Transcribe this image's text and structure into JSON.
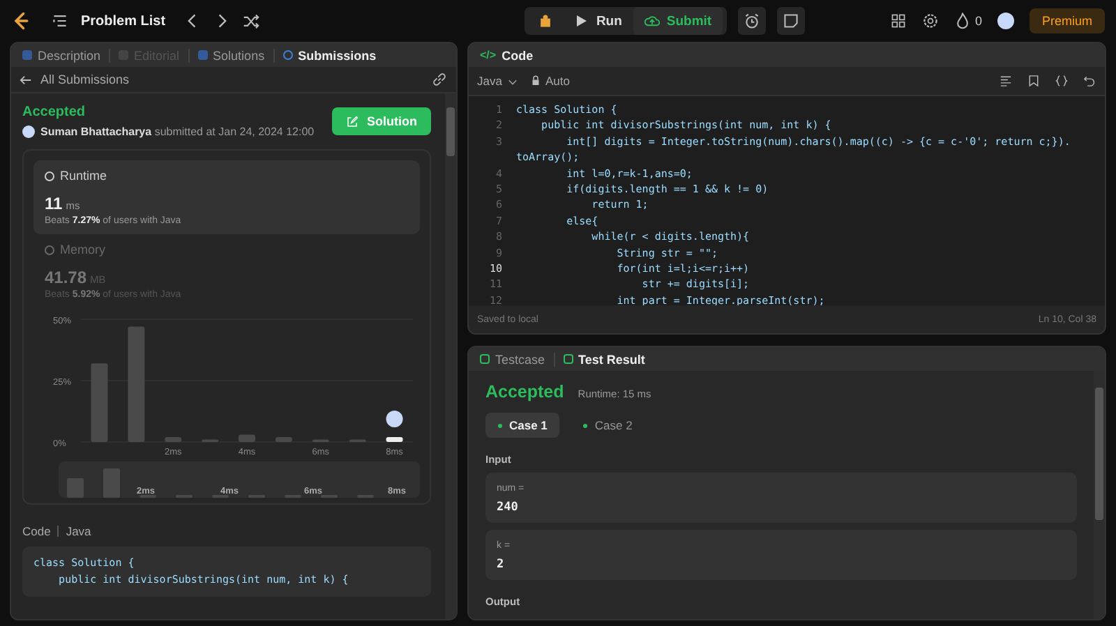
{
  "top_bar": {
    "title": "Problem List",
    "run_label": "Run",
    "submit_label": "Submit",
    "streak": "0",
    "premium": "Premium"
  },
  "left_panel": {
    "tabs": [
      {
        "label": "Description",
        "selected": false,
        "disabled": false
      },
      {
        "label": "Editorial",
        "selected": false,
        "disabled": true
      },
      {
        "label": "Solutions",
        "selected": false,
        "disabled": false
      },
      {
        "label": "Submissions",
        "selected": true,
        "disabled": false
      }
    ],
    "back_label": "All Submissions",
    "status": "Accepted",
    "author": "Suman Bhattacharya",
    "submitted": "submitted at Jan 24, 2024 12:00",
    "solution_button": "Solution",
    "stats": [
      {
        "title": "Runtime",
        "value": "11",
        "unit": "ms",
        "beats_prefix": "Beats",
        "beats": "7.27%",
        "beats_suffix": "of users with Java",
        "selected": true
      },
      {
        "title": "Memory",
        "value": "41.78",
        "unit": "MB",
        "beats_prefix": "Beats",
        "beats": "5.92%",
        "beats_suffix": "of users with Java",
        "selected": false
      }
    ],
    "chart_data": {
      "type": "bar",
      "x": [
        0,
        1,
        2,
        3,
        4,
        5,
        6,
        7,
        8
      ],
      "values": [
        32,
        47,
        2,
        1,
        3,
        2,
        1,
        1,
        2
      ],
      "ylim": [
        0,
        50
      ],
      "yticks": [
        {
          "value": 0,
          "label": "0%"
        },
        {
          "value": 25,
          "label": "25%"
        },
        {
          "value": 50,
          "label": "50%"
        }
      ],
      "xticks": [
        {
          "value": 2,
          "label": "2ms"
        },
        {
          "value": 4,
          "label": "4ms"
        },
        {
          "value": 6,
          "label": "6ms"
        },
        {
          "value": 8,
          "label": "8ms"
        }
      ],
      "xlim": [
        -0.5,
        8.5
      ]
    },
    "chart_bars": [
      {
        "selected": false
      },
      {
        "selected": false
      },
      {
        "selected": false
      },
      {
        "selected": false
      },
      {
        "selected": false
      },
      {
        "selected": false
      },
      {
        "selected": false
      },
      {
        "selected": false
      },
      {
        "selected": true
      }
    ],
    "overview_labels": [
      "2ms",
      "4ms",
      "6ms",
      "8ms"
    ],
    "code_label": "Code",
    "code_language": "Java",
    "code_lines": [
      "class Solution {",
      "    public int divisorSubstrings(int num, int k) {"
    ]
  },
  "code_panel": {
    "title": "Code",
    "title_icon": "</>",
    "language": "Java",
    "mode": "Auto",
    "lines": [
      {
        "number": "1",
        "text": "class Solution {",
        "current": false
      },
      {
        "number": "2",
        "text": "    public int divisorSubstrings(int num, int k) {",
        "current": false
      },
      {
        "number": "3",
        "text": "        int[] digits = Integer.toString(num).chars().map((c) -> {c = c-'0'; return c;}).",
        "continuation": "toArray();",
        "current": false
      },
      {
        "number": "4",
        "text": "        int l=0,r=k-1,ans=0;",
        "current": false
      },
      {
        "number": "5",
        "text": "        if(digits.length == 1 && k != 0)",
        "current": false
      },
      {
        "number": "6",
        "text": "            return 1;",
        "current": false
      },
      {
        "number": "7",
        "text": "        else{",
        "current": false
      },
      {
        "number": "8",
        "text": "            while(r < digits.length){",
        "current": false
      },
      {
        "number": "9",
        "text": "                String str = \"\";",
        "current": false
      },
      {
        "number": "10",
        "text": "                for(int i=l;i<=r;i++)",
        "current": true
      },
      {
        "number": "11",
        "text": "                    str += digits[i];",
        "current": false
      },
      {
        "number": "12",
        "text": "                int part = Integer.parseInt(str);",
        "current": false
      }
    ],
    "saved": "Saved to local",
    "cursor": "Ln 10, Col 38"
  },
  "test_panel": {
    "tabs": [
      {
        "label": "Testcase",
        "selected": false
      },
      {
        "label": "Test Result",
        "selected": true
      }
    ],
    "status": "Accepted",
    "runtime": "Runtime: 15 ms",
    "cases": [
      {
        "label": "Case 1",
        "selected": true
      },
      {
        "label": "Case 2",
        "selected": false
      }
    ],
    "input_label": "Input",
    "inputs": [
      {
        "name": "num =",
        "value": "240"
      },
      {
        "name": "k =",
        "value": "2"
      }
    ],
    "output_label": "Output"
  }
}
